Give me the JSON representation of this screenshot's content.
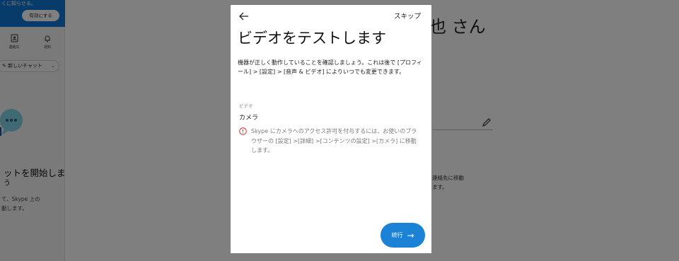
{
  "background": {
    "banner": {
      "text": "くに知らせる。",
      "enable_button": "有効にする"
    },
    "nav": [
      {
        "label": "連絡先",
        "icon": "contacts-icon"
      },
      {
        "label": "通知",
        "icon": "bell-icon"
      }
    ],
    "new_chat_label": "新しいチャット",
    "start_chat_title": "ットを開始しま",
    "start_chat_title2": "う",
    "start_chat_desc": [
      "て、Skype 上の",
      "動します。"
    ],
    "profile_name": "也 さん",
    "side_text": [
      "連絡先に移動",
      "ます。"
    ]
  },
  "modal": {
    "skip_label": "スキップ",
    "title": "ビデオをテストします",
    "description": "機器が正しく動作していることを確認しましょう。これは後で [プロフィール] > [設定] > [音声 & ビデオ] によりいつでも変更できます。",
    "section_label": "ビデオ",
    "camera_label": "カメラ",
    "warning_text": "Skype にカメラへのアクセス許可を付与するには、お使いのブラウザーの [設定] >[詳細] >[コンテンツの設定] >[カメラ] に移動します。",
    "continue_label": "続行",
    "continue_arrow": "→"
  },
  "colors": {
    "accent": "#1b82d6",
    "banner": "#0f77d2",
    "warning": "#d13438"
  }
}
